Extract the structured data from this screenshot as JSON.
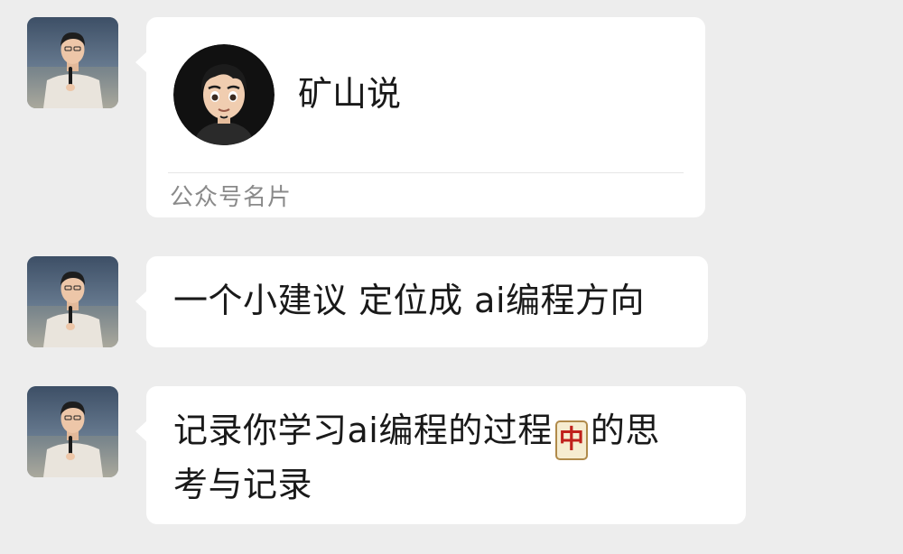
{
  "messages": [
    {
      "type": "card",
      "card_name": "矿山说",
      "card_type": "公众号名片"
    },
    {
      "type": "text",
      "text": "一个小建议 定位成 ai编程方向"
    },
    {
      "type": "text",
      "text_part1": "记录你学习ai编程的过程",
      "emoji_glyph": "中",
      "emoji_name": "mahjong-red-dragon-icon",
      "text_part2": "的思\n考与记录"
    }
  ],
  "colors": {
    "background": "#ededed",
    "bubble": "#ffffff",
    "secondary_text": "#8a8a8a"
  }
}
